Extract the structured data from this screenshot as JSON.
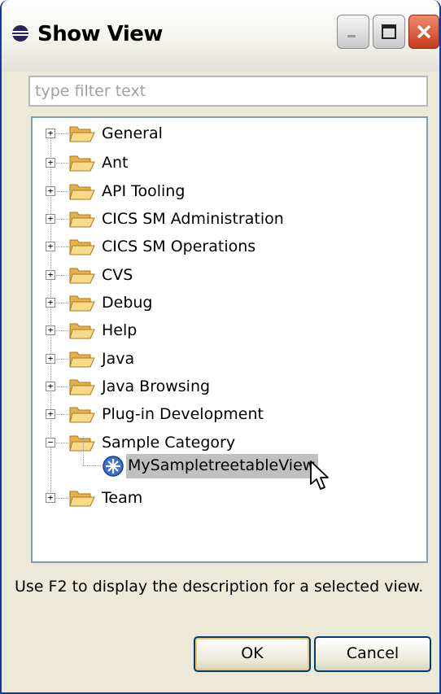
{
  "window": {
    "title": "Show View"
  },
  "filter": {
    "placeholder": "type filter text"
  },
  "tree": {
    "items": [
      {
        "label": "General",
        "expander": "+"
      },
      {
        "label": "Ant",
        "expander": "+"
      },
      {
        "label": "API Tooling",
        "expander": "+"
      },
      {
        "label": "CICS SM Administration",
        "expander": "+"
      },
      {
        "label": "CICS SM Operations",
        "expander": "+"
      },
      {
        "label": "CVS",
        "expander": "+"
      },
      {
        "label": "Debug",
        "expander": "+"
      },
      {
        "label": "Help",
        "expander": "+"
      },
      {
        "label": "Java",
        "expander": "+"
      },
      {
        "label": "Java Browsing",
        "expander": "+"
      },
      {
        "label": "Plug-in Development",
        "expander": "+"
      },
      {
        "label": "Sample Category",
        "expander": "−"
      },
      {
        "label": "Team",
        "expander": "+"
      }
    ],
    "child": {
      "label": "MySampletreetableView",
      "selected": true
    }
  },
  "hint": "Use F2 to display the description for a selected view.",
  "buttons": {
    "ok": "OK",
    "cancel": "Cancel"
  },
  "colors": {
    "titlebar_border": "#0b3c9e",
    "tree_border": "#7f9db9",
    "selection": "#c0c0c0",
    "folder": "#f2c66d"
  },
  "icons": {
    "title": "eclipse-icon",
    "folder": "folder-icon",
    "view": "view-icon"
  }
}
